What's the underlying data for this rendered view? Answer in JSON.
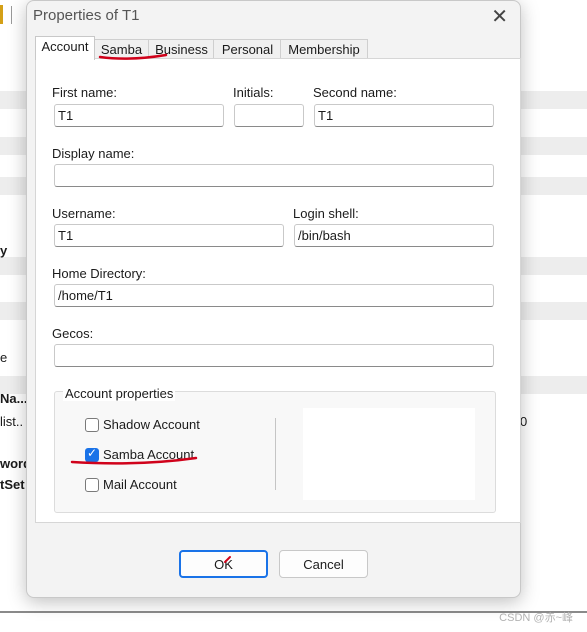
{
  "window": {
    "title": "Properties of T1",
    "close_glyph": "✕"
  },
  "tabs": [
    {
      "label": "Account",
      "active": true
    },
    {
      "label": "Samba",
      "active": false
    },
    {
      "label": "Business",
      "active": false
    },
    {
      "label": "Personal",
      "active": false
    },
    {
      "label": "Membership",
      "active": false
    }
  ],
  "form": {
    "first_name": {
      "label": "First name:",
      "value": "T1"
    },
    "initials": {
      "label": "Initials:",
      "value": ""
    },
    "second_name": {
      "label": "Second name:",
      "value": "T1"
    },
    "display_name": {
      "label": "Display name:",
      "value": ""
    },
    "username": {
      "label": "Username:",
      "value": "T1"
    },
    "login_shell": {
      "label": "Login shell:",
      "value": "/bin/bash"
    },
    "home_directory": {
      "label": "Home Directory:",
      "value": "/home/T1"
    },
    "gecos": {
      "label": "Gecos:",
      "value": ""
    }
  },
  "account_properties": {
    "title": "Account properties",
    "shadow": {
      "label": "Shadow Account",
      "checked": false
    },
    "samba": {
      "label": "Samba Account",
      "checked": true
    },
    "mail": {
      "label": "Mail Account",
      "checked": false
    }
  },
  "buttons": {
    "ok": "OK",
    "cancel": "Cancel"
  },
  "background": {
    "left_fragments": [
      "y",
      "e",
      "Na...",
      "list..",
      "word",
      "tSet"
    ],
    "right_fragment": "0"
  },
  "watermark": "CSDN @赤~峰",
  "colors": {
    "accent": "#1a73e8",
    "annotation_ink": "#d0021b"
  }
}
